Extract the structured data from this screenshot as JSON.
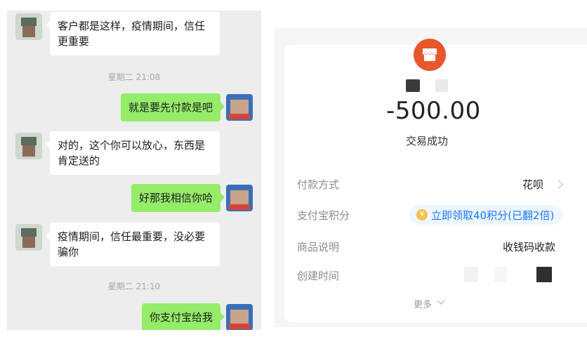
{
  "chat": {
    "messages": [
      {
        "side": "left",
        "text": "客户都是这样，疫情期间，信任更重要"
      },
      {
        "side": "right",
        "text": "就是要先付款是吧"
      },
      {
        "side": "left",
        "text": "对的，这个你可以放心，东西是肯定送的"
      },
      {
        "side": "right",
        "text": "好那我相信你哈"
      },
      {
        "side": "left",
        "text": "疫情期间，信任最重要，没必要骗你"
      },
      {
        "side": "right",
        "text": "你支付宝给我"
      }
    ],
    "timestamps": [
      "星期二 21:08",
      "星期二 21:10"
    ]
  },
  "payment": {
    "shop_icon": "store-icon",
    "amount": "-500.00",
    "status": "交易成功",
    "rows": {
      "method": {
        "label": "付款方式",
        "value": "花呗"
      },
      "points": {
        "label": "支付宝积分",
        "value": "立即领取40积分(已翻2倍)"
      },
      "product": {
        "label": "商品说明",
        "value": "收钱码收款"
      },
      "created": {
        "label": "创建时间"
      }
    },
    "more": "更多"
  },
  "colors": {
    "chat_bg": "#ededed",
    "bubble_green": "#95ec69",
    "shop_orange": "#e8572b",
    "points_blue": "#1677ff"
  }
}
